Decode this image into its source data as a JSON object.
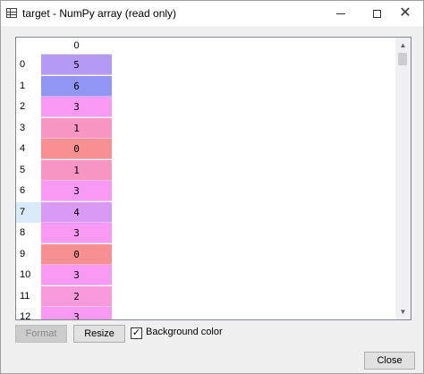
{
  "window": {
    "title": "target - NumPy array (read only)",
    "icon": "grid-table-icon"
  },
  "table": {
    "column_header": "0",
    "rows": [
      {
        "index": "0",
        "value": "5",
        "color": "#b49af4"
      },
      {
        "index": "1",
        "value": "6",
        "color": "#9196f4"
      },
      {
        "index": "2",
        "value": "3",
        "color": "#f89af4"
      },
      {
        "index": "3",
        "value": "1",
        "color": "#f896c4"
      },
      {
        "index": "4",
        "value": "0",
        "color": "#f88f92"
      },
      {
        "index": "5",
        "value": "1",
        "color": "#f896c4"
      },
      {
        "index": "6",
        "value": "3",
        "color": "#f89af4"
      },
      {
        "index": "7",
        "value": "4",
        "color": "#d89af4"
      },
      {
        "index": "8",
        "value": "3",
        "color": "#f89af4"
      },
      {
        "index": "9",
        "value": "0",
        "color": "#f88f92"
      },
      {
        "index": "10",
        "value": "3",
        "color": "#f89af4"
      },
      {
        "index": "11",
        "value": "2",
        "color": "#f89adc"
      },
      {
        "index": "12",
        "value": "3",
        "color": "#f89af4"
      }
    ],
    "selected_row": "7"
  },
  "controls": {
    "format_label": "Format",
    "resize_label": "Resize",
    "background_color_label": "Background color",
    "background_color_checked": "✓",
    "close_label": "Close"
  }
}
